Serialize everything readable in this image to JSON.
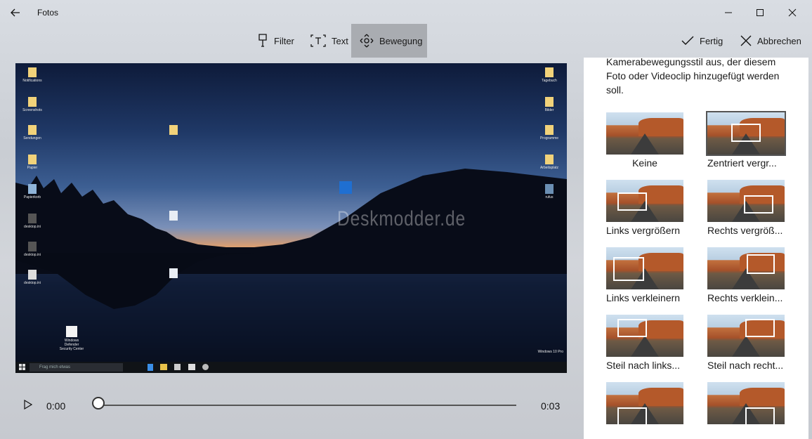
{
  "window": {
    "title": "Fotos"
  },
  "toolbar": {
    "filter_label": "Filter",
    "text_label": "Text",
    "motion_label": "Bewegung",
    "done_label": "Fertig",
    "cancel_label": "Abbrechen"
  },
  "preview": {
    "watermark": "Deskmodder.de",
    "taskbar_search": "Frag mich etwas",
    "desktop_icons": [
      "Notifications",
      "Screenshots",
      "Sendungen",
      "Papier",
      "Papierkorb",
      "desktop.ini",
      "desktop.ini",
      "desktop.ini",
      "Tagebuch",
      "Bilder",
      "Programme",
      "Arbeitsplatz",
      "rufus",
      "Windows Defender",
      "Security Center",
      "Windows 10 Pro"
    ]
  },
  "playback": {
    "current_time": "0:00",
    "total_time": "0:03",
    "progress": 0
  },
  "panel": {
    "description": "Kamerabewegungsstil aus, der diesem Foto oder Videoclip hinzugefügt werden soll.",
    "options": [
      {
        "label": "Keine"
      },
      {
        "label": "Zentriert vergr..."
      },
      {
        "label": "Links vergrößern"
      },
      {
        "label": "Rechts vergröß..."
      },
      {
        "label": "Links verkleinern"
      },
      {
        "label": "Rechts verklein..."
      },
      {
        "label": "Steil nach links..."
      },
      {
        "label": "Steil nach recht..."
      },
      {
        "label": ""
      },
      {
        "label": ""
      }
    ],
    "selected_index": 1
  },
  "colors": {
    "accent_active": "#a9acb1",
    "panel_bg": "#ffffff"
  }
}
